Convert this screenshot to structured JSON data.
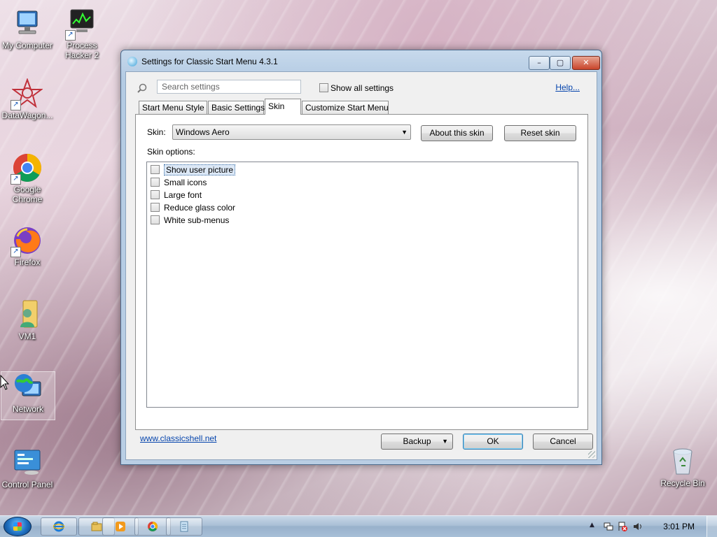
{
  "desktop": {
    "icons": [
      {
        "label": "My Computer"
      },
      {
        "label": "Process Hacker 2"
      },
      {
        "label": "DataWagon..."
      },
      {
        "label": "Google Chrome"
      },
      {
        "label": "Firefox"
      },
      {
        "label": "VM1"
      },
      {
        "label": "Network"
      },
      {
        "label": "Control Panel"
      },
      {
        "label": "Recycle Bin"
      }
    ]
  },
  "window": {
    "title": "Settings for Classic Start Menu 4.3.1",
    "controls": {
      "minimize": "–",
      "maximize": "▢",
      "close": "✕"
    },
    "search": {
      "placeholder": "Search settings",
      "value": ""
    },
    "show_all_label": "Show all settings",
    "help_link": "Help...",
    "tabs": [
      {
        "label": "Start Menu Style",
        "active": false
      },
      {
        "label": "Basic Settings",
        "active": false
      },
      {
        "label": "Skin",
        "active": true
      },
      {
        "label": "Customize Start Menu",
        "active": false
      }
    ],
    "skin": {
      "label": "Skin:",
      "selected": "Windows Aero",
      "about_button": "About this skin",
      "reset_button": "Reset skin",
      "options_label": "Skin options:",
      "options": [
        {
          "label": "Show user picture",
          "checked": false,
          "focused": true
        },
        {
          "label": "Small icons",
          "checked": false
        },
        {
          "label": "Large font",
          "checked": false
        },
        {
          "label": "Reduce glass color",
          "checked": false
        },
        {
          "label": "White sub-menus",
          "checked": false
        }
      ]
    },
    "footer": {
      "link": "www.classicshell.net",
      "backup_button": "Backup",
      "ok_button": "OK",
      "cancel_button": "Cancel"
    }
  },
  "taskbar": {
    "items": [
      {
        "icon": "internet-explorer-icon"
      },
      {
        "icon": "windows-explorer-icon"
      },
      {
        "icon": "media-player-icon"
      },
      {
        "icon": "chrome-icon"
      },
      {
        "icon": "notepad-icon"
      }
    ],
    "clock": "3:01 PM"
  },
  "colors": {
    "titlebar": "#c7d9ec",
    "link": "#0645ad",
    "close_button": "#c9452b"
  }
}
